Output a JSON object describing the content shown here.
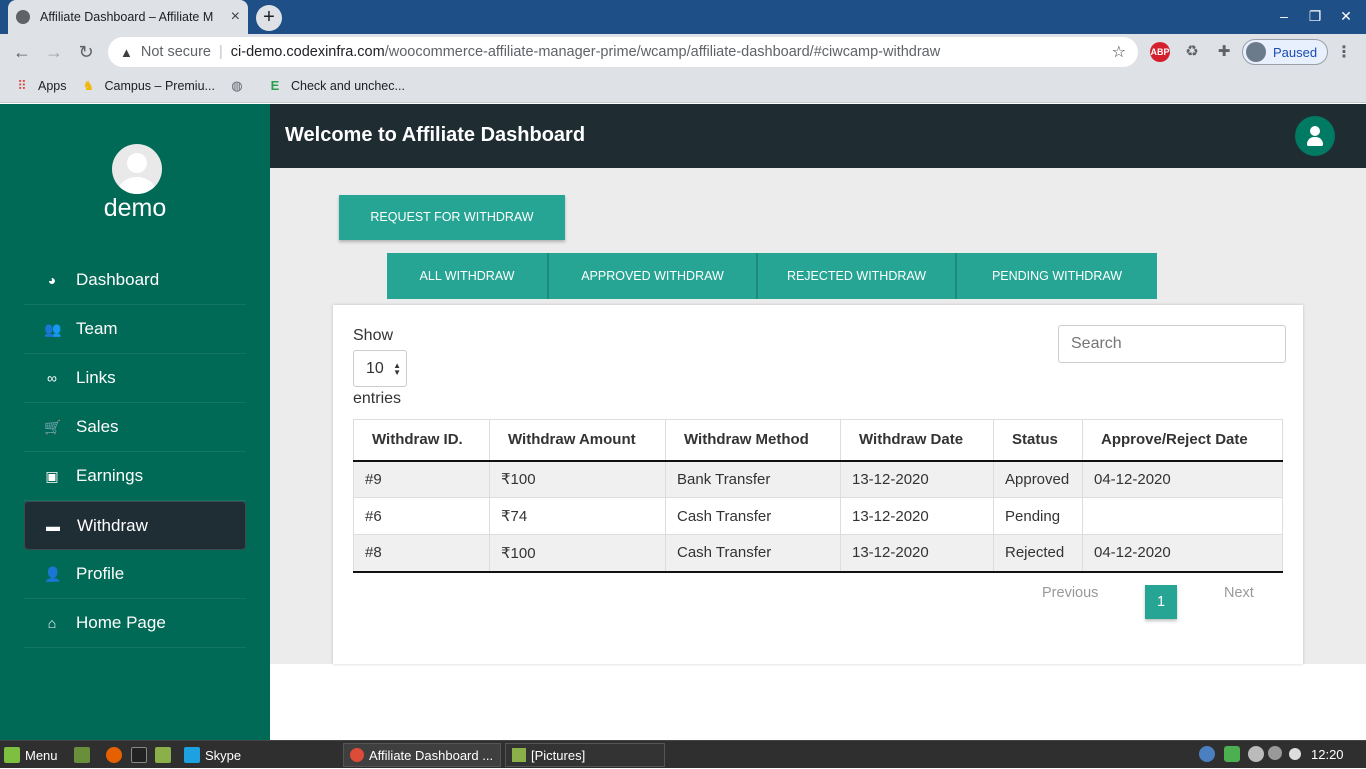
{
  "browser": {
    "tab_title": "Affiliate Dashboard – Affiliate M",
    "new_tab": "+",
    "url_warning": "Not secure",
    "url_host": "ci-demo.codexinfra.com",
    "url_path": "/woocommerce-affiliate-manager-prime/wcamp/affiliate-dashboard/#ciwcamp-withdraw",
    "profile_status": "Paused",
    "bookmarks": [
      {
        "label": "Apps",
        "icon": "apps-grid-icon"
      },
      {
        "label": "Campus – Premiu...",
        "icon": "campus-icon"
      },
      {
        "label": "",
        "icon": "globe-icon"
      },
      {
        "label": "Check and unchec...",
        "icon": "e-icon"
      }
    ]
  },
  "sidebar": {
    "username": "demo",
    "items": [
      {
        "label": "Dashboard",
        "icon": "pie-chart-icon"
      },
      {
        "label": "Team",
        "icon": "users-icon"
      },
      {
        "label": "Links",
        "icon": "link-icon"
      },
      {
        "label": "Sales",
        "icon": "cart-icon"
      },
      {
        "label": "Earnings",
        "icon": "money-icon"
      },
      {
        "label": "Withdraw",
        "icon": "credit-card-icon",
        "active": true
      },
      {
        "label": "Profile",
        "icon": "user-icon"
      },
      {
        "label": "Home Page",
        "icon": "home-icon"
      }
    ]
  },
  "header": {
    "title": "Welcome to Affiliate Dashboard"
  },
  "main": {
    "request_button": "REQUEST FOR WITHDRAW",
    "tabs": [
      "ALL WITHDRAW",
      "APPROVED WITHDRAW",
      "REJECTED WITHDRAW",
      "PENDING WITHDRAW"
    ],
    "length_show": "Show",
    "length_value": "10",
    "length_entries": "entries",
    "search_placeholder": "Search",
    "columns": [
      "Withdraw ID.",
      "Withdraw Amount",
      "Withdraw Method",
      "Withdraw Date",
      "Status",
      "Approve/Reject Date"
    ],
    "rows": [
      [
        "#9",
        "₹100",
        "Bank Transfer",
        "13-12-2020",
        "Approved",
        "04-12-2020"
      ],
      [
        "#6",
        "₹74",
        "Cash Transfer",
        "13-12-2020",
        "Pending",
        ""
      ],
      [
        "#8",
        "₹100",
        "Cash Transfer",
        "13-12-2020",
        "Rejected",
        "04-12-2020"
      ]
    ],
    "pagination": {
      "previous": "Previous",
      "current": "1",
      "next": "Next"
    }
  },
  "taskbar": {
    "menu": "Menu",
    "skype": "Skype",
    "chrome_window": "Affiliate Dashboard ...",
    "files_window": "[Pictures]",
    "time": "12:20"
  },
  "colors": {
    "sidebar": "#006a56",
    "accent": "#26a594",
    "header": "#1f2d33"
  }
}
